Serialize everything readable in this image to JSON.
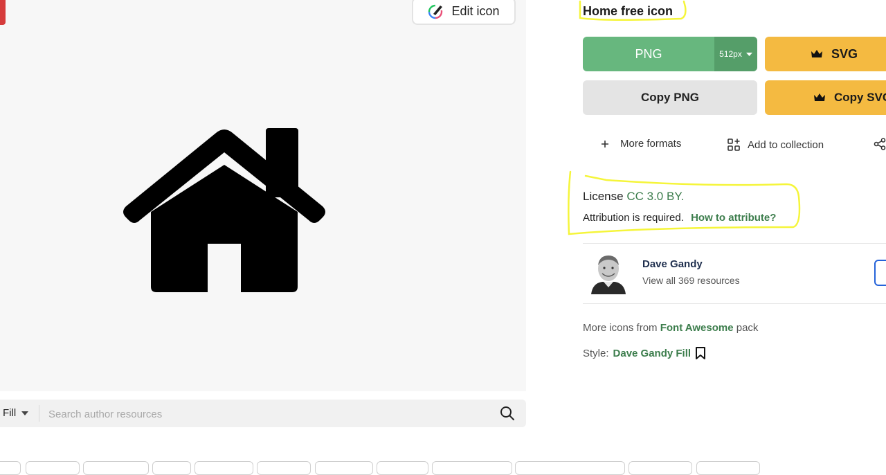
{
  "preview": {
    "edit_button_label": "Edit icon"
  },
  "search": {
    "style_value": "Fill",
    "placeholder": "Search author resources"
  },
  "icon": {
    "title": "Home free icon"
  },
  "download": {
    "png_label": "PNG",
    "png_size": "512px",
    "svg_label": "SVG",
    "copy_png_label": "Copy PNG",
    "copy_svg_label": "Copy SVG"
  },
  "actions": {
    "more_formats": "More formats",
    "add_collection": "Add to collection"
  },
  "license": {
    "prefix": "License",
    "name": "CC 3.0 BY.",
    "attribution_text": "Attribution is required.",
    "attribution_link": "How to attribute?"
  },
  "author": {
    "name": "Dave Gandy",
    "resources": "View all 369 resources"
  },
  "pack": {
    "prefix": "More icons from",
    "name": "Font Awesome",
    "suffix": "pack"
  },
  "style": {
    "label": "Style:",
    "name": "Dave Gandy Fill"
  },
  "colors": {
    "png_green": "#67b77e",
    "premium_yellow": "#f4ba41",
    "link_green": "#3c7d4c",
    "highlight_yellow": "#f5f53a"
  }
}
